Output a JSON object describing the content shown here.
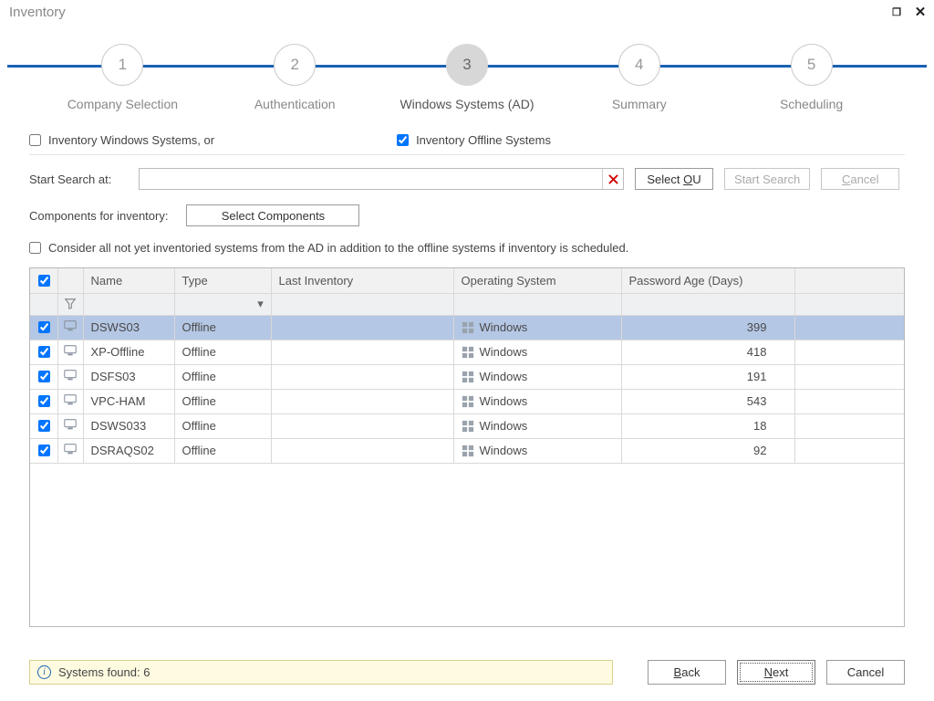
{
  "window": {
    "title": "Inventory"
  },
  "steps": [
    {
      "num": "1",
      "label": "Company Selection"
    },
    {
      "num": "2",
      "label": "Authentication"
    },
    {
      "num": "3",
      "label": "Windows Systems (AD)"
    },
    {
      "num": "4",
      "label": "Summary"
    },
    {
      "num": "5",
      "label": "Scheduling"
    }
  ],
  "active_step": 3,
  "checkboxes": {
    "inventory_windows": "Inventory Windows Systems, or",
    "inventory_offline": "Inventory Offline Systems"
  },
  "search": {
    "label": "Start Search at:",
    "value": "",
    "select_ou_prefix": "Select ",
    "select_ou_key": "O",
    "select_ou_suffix": "U",
    "start_search": "Start Search",
    "cancel_prefix": "",
    "cancel_key": "C",
    "cancel_suffix": "ancel"
  },
  "components": {
    "label": "Components for inventory:",
    "button": "Select Components"
  },
  "consider": "Consider all not yet inventoried systems from the AD in addition to the offline systems if inventory is scheduled.",
  "columns": {
    "name": "Name",
    "type": "Type",
    "lastinv": "Last Inventory",
    "os": "Operating System",
    "age": "Password Age (Days)"
  },
  "rows": [
    {
      "name": "DSWS03",
      "type": "Offline",
      "lastinv": "",
      "os": "Windows",
      "age": "399",
      "selected": true
    },
    {
      "name": "XP-Offline",
      "type": "Offline",
      "lastinv": "",
      "os": "Windows",
      "age": "418",
      "selected": false
    },
    {
      "name": "DSFS03",
      "type": "Offline",
      "lastinv": "",
      "os": "Windows",
      "age": "191",
      "selected": false
    },
    {
      "name": "VPC-HAM",
      "type": "Offline",
      "lastinv": "",
      "os": "Windows",
      "age": "543",
      "selected": false
    },
    {
      "name": "DSWS033",
      "type": "Offline",
      "lastinv": "",
      "os": "Windows",
      "age": "18",
      "selected": false
    },
    {
      "name": "DSRAQS02",
      "type": "Offline",
      "lastinv": "",
      "os": "Windows",
      "age": "92",
      "selected": false
    }
  ],
  "status": {
    "text": "Systems found:  6"
  },
  "footer": {
    "back_prefix": "",
    "back_key": "B",
    "back_suffix": "ack",
    "next_prefix": "",
    "next_key": "N",
    "next_suffix": "ext",
    "cancel": "Cancel"
  }
}
